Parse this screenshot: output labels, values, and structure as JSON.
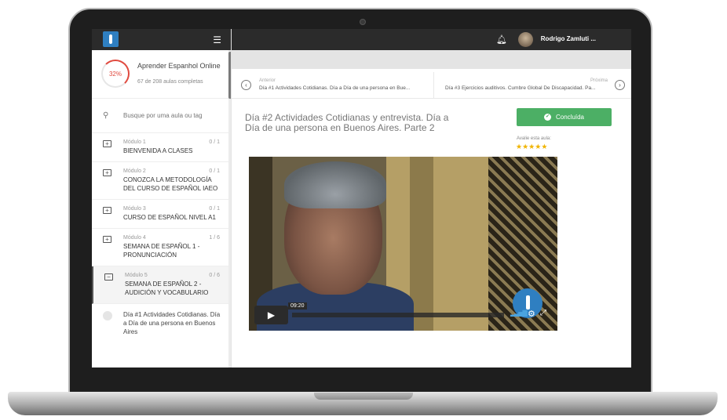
{
  "course": {
    "progress_percent": "32%",
    "progress_fraction": 0.32,
    "title": "Aprender Espanhol Online",
    "subtitle": "67 de 208 aulas completas"
  },
  "search": {
    "placeholder": "Busque por uma aula ou tag"
  },
  "modules": [
    {
      "label": "Módulo 1",
      "count": "0 / 1",
      "name": "BIENVENIDA A CLASES"
    },
    {
      "label": "Módulo 2",
      "count": "0 / 1",
      "name": "CONOZCA LA METODOLOGÍA DEL CURSO DE ESPAÑOL IAEO"
    },
    {
      "label": "Módulo 3",
      "count": "0 / 1",
      "name": "CURSO DE ESPAÑOL NIVEL A1"
    },
    {
      "label": "Módulo 4",
      "count": "1 / 6",
      "name": "SEMANA DE ESPAÑOL 1 - PRONUNCIACIÓN"
    },
    {
      "label": "Módulo 5",
      "count": "0 / 6",
      "name": "SEMANA DE ESPAÑOL 2 - AUDICIÓN Y VOCABULARIO"
    }
  ],
  "sub_lesson": "Día #1 Actividades Cotidianas. Día a Día de una persona en Buenos Aires",
  "topbar": {
    "user_name": "Rodrigo Zamluti ..."
  },
  "nav": {
    "prev_label": "Anterior",
    "prev_title": "Día #1 Actividades Cotidianas. Día a Día de una persona en Bue...",
    "next_label": "Próxima",
    "next_title": "Día #3 Ejercicios auditivos. Cumbre Global De Discapacidad. Pa..."
  },
  "lesson": {
    "title": "Día #2 Actividades Cotidianas y entrevista. Día a Día de una persona en Buenos Aires. Parte 2",
    "done_label": "Concluída",
    "rate_label": "Avalie esta aula:",
    "rating": 5
  },
  "video": {
    "time": "09:20"
  },
  "colors": {
    "accent_green": "#4caf65",
    "progress_red": "#e04a3f",
    "brand_blue": "#2f7fc1"
  }
}
